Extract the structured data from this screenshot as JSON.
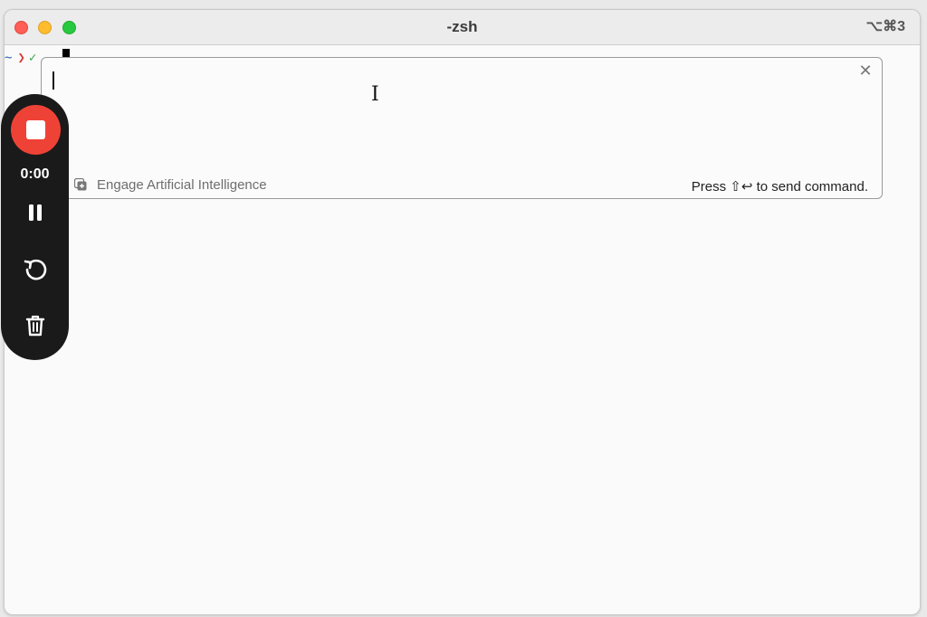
{
  "window": {
    "title": "-zsh",
    "shortcut": "⌥⌘3"
  },
  "terminal": {
    "prompt_path": "~",
    "prompt_arrow": "❯",
    "prompt_symbol": "✓"
  },
  "ai_box": {
    "input_value": "",
    "engage_label": "Engage Artificial Intelligence",
    "hint": "Press ⇧↩ to send command.",
    "close_icon": "close-icon"
  },
  "recorder": {
    "time": "0:00",
    "stop_color": "#ef4236",
    "icons": [
      "stop-icon",
      "pause-icon",
      "restart-icon",
      "trash-icon"
    ]
  }
}
